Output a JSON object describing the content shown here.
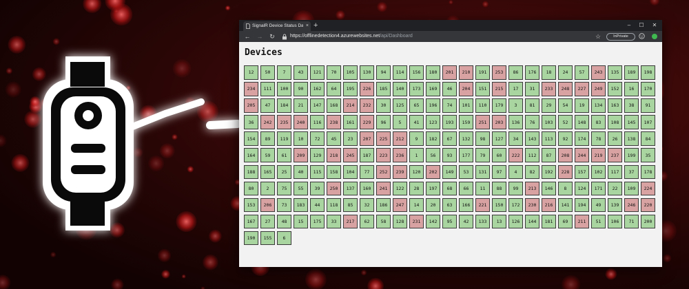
{
  "browser": {
    "tab_title": "SignalR Device Status Dashboard",
    "tab_close": "×",
    "new_tab": "+",
    "window_controls": {
      "minimize": "–",
      "maximize": "☐",
      "close": "✕"
    },
    "address_host": "https://offlinedetection4.azurewebsites.net",
    "address_path": "/api/Dashboard",
    "inprivate_label": "InPrivate",
    "nav_icons": {
      "back": "←",
      "forward": "→",
      "refresh": "↻",
      "favorite": "☆"
    }
  },
  "page": {
    "heading": "Devices"
  },
  "colors": {
    "online": "#a9d6a0",
    "offline": "#d9a2a2",
    "background_accent": "#b01010"
  },
  "devices": [
    [
      [
        12,
        "online"
      ],
      [
        50,
        "online"
      ],
      [
        7,
        "online"
      ],
      [
        43,
        "online"
      ],
      [
        121,
        "online"
      ],
      [
        70,
        "online"
      ],
      [
        105,
        "online"
      ],
      [
        130,
        "online"
      ],
      [
        94,
        "online"
      ],
      [
        114,
        "online"
      ],
      [
        156,
        "online"
      ],
      [
        180,
        "online"
      ],
      [
        201,
        "offline"
      ],
      [
        210,
        "offline"
      ],
      [
        191,
        "online"
      ],
      [
        253,
        "offline"
      ],
      [
        86,
        "online"
      ],
      [
        176,
        "online"
      ],
      [
        18,
        "online"
      ],
      [
        24,
        "online"
      ],
      [
        57,
        "online"
      ],
      [
        243,
        "offline"
      ],
      [
        135,
        "online"
      ]
    ],
    [
      [
        189,
        "online"
      ],
      [
        198,
        "online"
      ],
      [
        234,
        "offline"
      ],
      [
        111,
        "online"
      ],
      [
        100,
        "online"
      ],
      [
        90,
        "online"
      ],
      [
        162,
        "online"
      ],
      [
        64,
        "online"
      ],
      [
        195,
        "online"
      ],
      [
        226,
        "offline"
      ],
      [
        185,
        "online"
      ],
      [
        140,
        "online"
      ],
      [
        173,
        "online"
      ],
      [
        169,
        "online"
      ],
      [
        46,
        "online"
      ],
      [
        204,
        "offline"
      ],
      [
        151,
        "online"
      ],
      [
        215,
        "offline"
      ],
      [
        17,
        "online"
      ],
      [
        31,
        "online"
      ],
      [
        233,
        "offline"
      ],
      [
        248,
        "offline"
      ],
      [
        227,
        "offline"
      ]
    ],
    [
      [
        249,
        "offline"
      ],
      [
        152,
        "online"
      ],
      [
        16,
        "online"
      ],
      [
        170,
        "online"
      ],
      [
        205,
        "offline"
      ],
      [
        47,
        "online"
      ],
      [
        184,
        "online"
      ],
      [
        21,
        "online"
      ],
      [
        147,
        "online"
      ],
      [
        168,
        "online"
      ],
      [
        214,
        "offline"
      ],
      [
        232,
        "offline"
      ],
      [
        30,
        "online"
      ],
      [
        125,
        "online"
      ],
      [
        65,
        "online"
      ],
      [
        196,
        "online"
      ],
      [
        74,
        "online"
      ],
      [
        101,
        "online"
      ],
      [
        110,
        "online"
      ],
      [
        179,
        "online"
      ],
      [
        3,
        "online"
      ],
      [
        81,
        "online"
      ],
      [
        29,
        "online"
      ]
    ],
    [
      [
        54,
        "online"
      ],
      [
        19,
        "online"
      ],
      [
        134,
        "online"
      ],
      [
        163,
        "online"
      ],
      [
        38,
        "online"
      ],
      [
        91,
        "online"
      ],
      [
        36,
        "online"
      ],
      [
        242,
        "offline"
      ],
      [
        235,
        "offline"
      ],
      [
        240,
        "offline"
      ],
      [
        116,
        "online"
      ],
      [
        238,
        "offline"
      ],
      [
        161,
        "online"
      ],
      [
        229,
        "offline"
      ],
      [
        96,
        "online"
      ],
      [
        5,
        "online"
      ],
      [
        41,
        "online"
      ],
      [
        123,
        "online"
      ],
      [
        193,
        "online"
      ],
      [
        159,
        "online"
      ],
      [
        251,
        "offline"
      ],
      [
        203,
        "offline"
      ],
      [
        136,
        "online"
      ]
    ],
    [
      [
        76,
        "online"
      ],
      [
        103,
        "online"
      ],
      [
        52,
        "online"
      ],
      [
        148,
        "online"
      ],
      [
        83,
        "online"
      ],
      [
        108,
        "online"
      ],
      [
        145,
        "online"
      ],
      [
        107,
        "online"
      ],
      [
        154,
        "online"
      ],
      [
        89,
        "online"
      ],
      [
        119,
        "online"
      ],
      [
        10,
        "online"
      ],
      [
        72,
        "online"
      ],
      [
        45,
        "online"
      ],
      [
        23,
        "online"
      ],
      [
        207,
        "offline"
      ],
      [
        225,
        "offline"
      ],
      [
        212,
        "offline"
      ],
      [
        9,
        "online"
      ],
      [
        182,
        "online"
      ],
      [
        67,
        "online"
      ],
      [
        132,
        "online"
      ],
      [
        98,
        "online"
      ]
    ],
    [
      [
        127,
        "online"
      ],
      [
        34,
        "online"
      ],
      [
        143,
        "online"
      ],
      [
        113,
        "online"
      ],
      [
        92,
        "online"
      ],
      [
        174,
        "online"
      ],
      [
        78,
        "online"
      ],
      [
        26,
        "online"
      ],
      [
        138,
        "online"
      ],
      [
        84,
        "online"
      ],
      [
        164,
        "online"
      ],
      [
        59,
        "online"
      ],
      [
        61,
        "online"
      ],
      [
        209,
        "offline"
      ],
      [
        129,
        "online"
      ],
      [
        218,
        "offline"
      ],
      [
        245,
        "offline"
      ],
      [
        187,
        "online"
      ],
      [
        223,
        "offline"
      ],
      [
        236,
        "offline"
      ],
      [
        1,
        "online"
      ],
      [
        56,
        "online"
      ],
      [
        93,
        "online"
      ]
    ],
    [
      [
        177,
        "online"
      ],
      [
        79,
        "online"
      ],
      [
        60,
        "online"
      ],
      [
        222,
        "offline"
      ],
      [
        112,
        "online"
      ],
      [
        87,
        "online"
      ],
      [
        208,
        "offline"
      ],
      [
        244,
        "offline"
      ],
      [
        219,
        "offline"
      ],
      [
        237,
        "offline"
      ],
      [
        199,
        "online"
      ],
      [
        35,
        "online"
      ],
      [
        188,
        "online"
      ],
      [
        165,
        "online"
      ],
      [
        25,
        "online"
      ],
      [
        40,
        "online"
      ],
      [
        115,
        "online"
      ],
      [
        158,
        "online"
      ],
      [
        104,
        "online"
      ],
      [
        77,
        "online"
      ],
      [
        252,
        "offline"
      ],
      [
        239,
        "offline"
      ],
      [
        120,
        "online"
      ]
    ],
    [
      [
        202,
        "offline"
      ],
      [
        149,
        "online"
      ],
      [
        53,
        "online"
      ],
      [
        131,
        "online"
      ],
      [
        97,
        "online"
      ],
      [
        4,
        "online"
      ],
      [
        82,
        "online"
      ],
      [
        192,
        "online"
      ],
      [
        228,
        "offline"
      ],
      [
        157,
        "online"
      ],
      [
        102,
        "online"
      ],
      [
        117,
        "online"
      ],
      [
        37,
        "online"
      ],
      [
        178,
        "online"
      ],
      [
        80,
        "online"
      ],
      [
        2,
        "online"
      ],
      [
        75,
        "online"
      ],
      [
        55,
        "online"
      ],
      [
        39,
        "online"
      ],
      [
        250,
        "offline"
      ],
      [
        137,
        "online"
      ],
      [
        160,
        "online"
      ],
      [
        241,
        "offline"
      ]
    ],
    [
      [
        122,
        "online"
      ],
      [
        28,
        "online"
      ],
      [
        197,
        "online"
      ],
      [
        68,
        "online"
      ],
      [
        66,
        "online"
      ],
      [
        11,
        "online"
      ],
      [
        88,
        "online"
      ],
      [
        99,
        "online"
      ],
      [
        213,
        "offline"
      ],
      [
        146,
        "online"
      ],
      [
        8,
        "online"
      ],
      [
        124,
        "online"
      ],
      [
        171,
        "online"
      ],
      [
        22,
        "online"
      ],
      [
        109,
        "online"
      ],
      [
        224,
        "offline"
      ],
      [
        153,
        "online"
      ],
      [
        206,
        "offline"
      ],
      [
        73,
        "online"
      ],
      [
        183,
        "online"
      ],
      [
        44,
        "online"
      ],
      [
        118,
        "online"
      ],
      [
        85,
        "online"
      ]
    ],
    [
      [
        32,
        "online"
      ],
      [
        186,
        "online"
      ],
      [
        247,
        "offline"
      ],
      [
        14,
        "online"
      ],
      [
        20,
        "online"
      ],
      [
        63,
        "online"
      ],
      [
        166,
        "online"
      ],
      [
        221,
        "offline"
      ],
      [
        150,
        "online"
      ],
      [
        172,
        "online"
      ],
      [
        230,
        "offline"
      ],
      [
        216,
        "offline"
      ],
      [
        141,
        "online"
      ],
      [
        194,
        "online"
      ],
      [
        49,
        "online"
      ],
      [
        139,
        "online"
      ],
      [
        246,
        "offline"
      ],
      [
        220,
        "offline"
      ],
      [
        167,
        "online"
      ],
      [
        27,
        "online"
      ],
      [
        48,
        "online"
      ],
      [
        15,
        "online"
      ],
      [
        175,
        "online"
      ]
    ],
    [
      [
        33,
        "online"
      ],
      [
        217,
        "offline"
      ],
      [
        62,
        "online"
      ],
      [
        58,
        "online"
      ],
      [
        128,
        "online"
      ],
      [
        231,
        "offline"
      ],
      [
        142,
        "online"
      ],
      [
        95,
        "online"
      ],
      [
        42,
        "online"
      ],
      [
        133,
        "online"
      ],
      [
        13,
        "online"
      ],
      [
        126,
        "online"
      ],
      [
        144,
        "online"
      ],
      [
        181,
        "online"
      ],
      [
        69,
        "online"
      ],
      [
        211,
        "offline"
      ],
      [
        51,
        "online"
      ],
      [
        106,
        "online"
      ],
      [
        71,
        "online"
      ],
      [
        200,
        "online"
      ],
      [
        190,
        "online"
      ],
      [
        155,
        "online"
      ],
      [
        6,
        "online"
      ]
    ]
  ]
}
